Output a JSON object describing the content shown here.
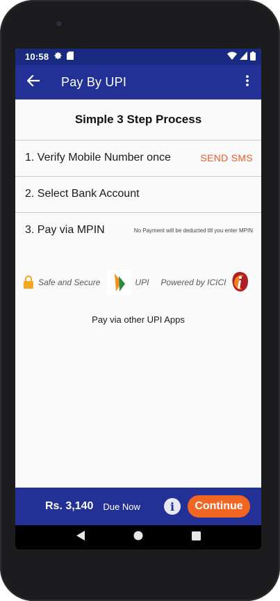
{
  "status_bar": {
    "time": "10:58",
    "icons": [
      "gear-icon",
      "sim-card-icon",
      "wifi-icon",
      "signal-icon",
      "battery-icon"
    ]
  },
  "app_bar": {
    "title": "Pay By UPI",
    "back_icon": "arrow-left-icon",
    "menu_icon": "more-vert-icon"
  },
  "header": {
    "title": "Simple 3 Step Process"
  },
  "steps": [
    {
      "label": "1. Verify Mobile Number once",
      "action": "SEND SMS"
    },
    {
      "label": "2. Select Bank Account"
    },
    {
      "label": "3. Pay via MPIN",
      "note": "No Payment will be deducted till you enter MPIN"
    }
  ],
  "badges": {
    "safe": "Safe and Secure",
    "upi": "UPI",
    "powered": "Powered by ICICI"
  },
  "other_apps": "Pay via other UPI Apps",
  "footer": {
    "amount": "Rs. 3,140",
    "due": "Due Now",
    "info": "i",
    "continue": "Continue"
  },
  "colors": {
    "primary": "#233196",
    "status_bar": "#1a2a80",
    "accent": "#f26522",
    "send_sms": "#f15a29"
  }
}
